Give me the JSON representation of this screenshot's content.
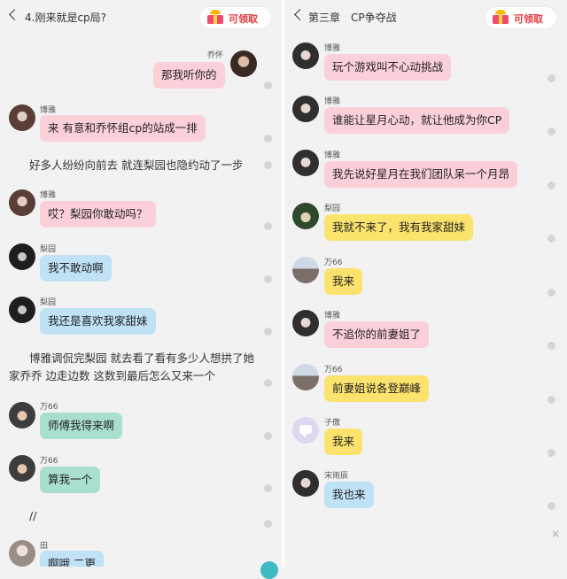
{
  "left": {
    "title": "4.刚来就是cp局?",
    "reward": "可领取",
    "m1_name": "乔怀",
    "m1_text": "那我听你的",
    "m2_name": "博雅",
    "m2_text": "来 有意和乔怀组cp的站成一排",
    "n1": "好多人纷纷向前去 就连梨园也隐约动了一步",
    "m3_name": "博雅",
    "m3_text": "哎？梨园你敢动吗？",
    "m4_name": "梨园",
    "m4_text": "我不敢动啊",
    "m5_name": "梨园",
    "m5_text": "我还是喜欢我家甜妹",
    "n2_line1": "博雅调侃完梨园 就去看了看有多少人想拱了她",
    "n2_line2": "家乔乔 边走边数 这数到最后怎么又来一个",
    "m6_name": "万66",
    "m6_text": "师傅我得来啊",
    "m7_name": "万66",
    "m7_text": "算我一个",
    "n3": "//",
    "m8_name": "田",
    "m8_text": "啊哦 二更"
  },
  "right": {
    "title": "第三章　CP争夺战",
    "reward": "可领取",
    "m1_name": "博雅",
    "m1_text": "玩个游戏叫不心动挑战",
    "m2_name": "博雅",
    "m2_text": "谁能让星月心动，就让他成为你CP",
    "m3_name": "博雅",
    "m3_text": "我先说好星月在我们团队呆一个月昂",
    "m4_name": "梨园",
    "m4_text": "我就不来了，我有我家甜妹",
    "m5_name": "万66",
    "m5_text": "我来",
    "m6_name": "博雅",
    "m6_text": "不追你的前妻姐了",
    "m7_name": "万66",
    "m7_text": "前妻姐说各登巅峰",
    "m8_name": "子傲",
    "m8_text": "我来",
    "m9_name": "宋雨辰",
    "m9_text": "我也来",
    "close": "×"
  },
  "colors": {
    "pink": "#fbd0d9",
    "blue": "#bfe2f7",
    "teal": "#a9dfd0",
    "yellow": "#fbe36d",
    "reward_text": "#e53c3c"
  },
  "icons": {
    "back": "chevron-left-icon",
    "reward": "gift-box-icon",
    "close": "close-icon"
  }
}
